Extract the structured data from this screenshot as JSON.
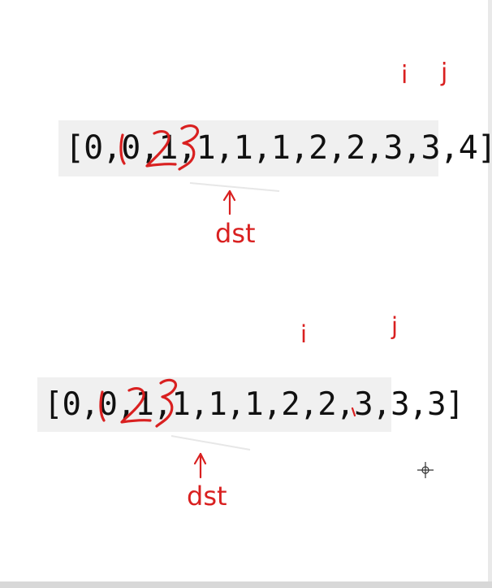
{
  "arrays": [
    {
      "text": "[0,0,1,1,1,1,2,2,3,3,4]"
    },
    {
      "text": "[0,0,1,1,1,1,2,2,3,3,3]"
    }
  ],
  "annotations": {
    "top": {
      "i": "i",
      "j": "j",
      "dst": "dst"
    },
    "bottom": {
      "i": "i",
      "j": "j",
      "dst": "dst"
    }
  },
  "colors": {
    "annotation": "#d92020",
    "array_text": "#111111",
    "array_bg": "#f0f0f0"
  },
  "icons": [
    "up-arrow-icon",
    "crosshair-cursor-icon"
  ]
}
